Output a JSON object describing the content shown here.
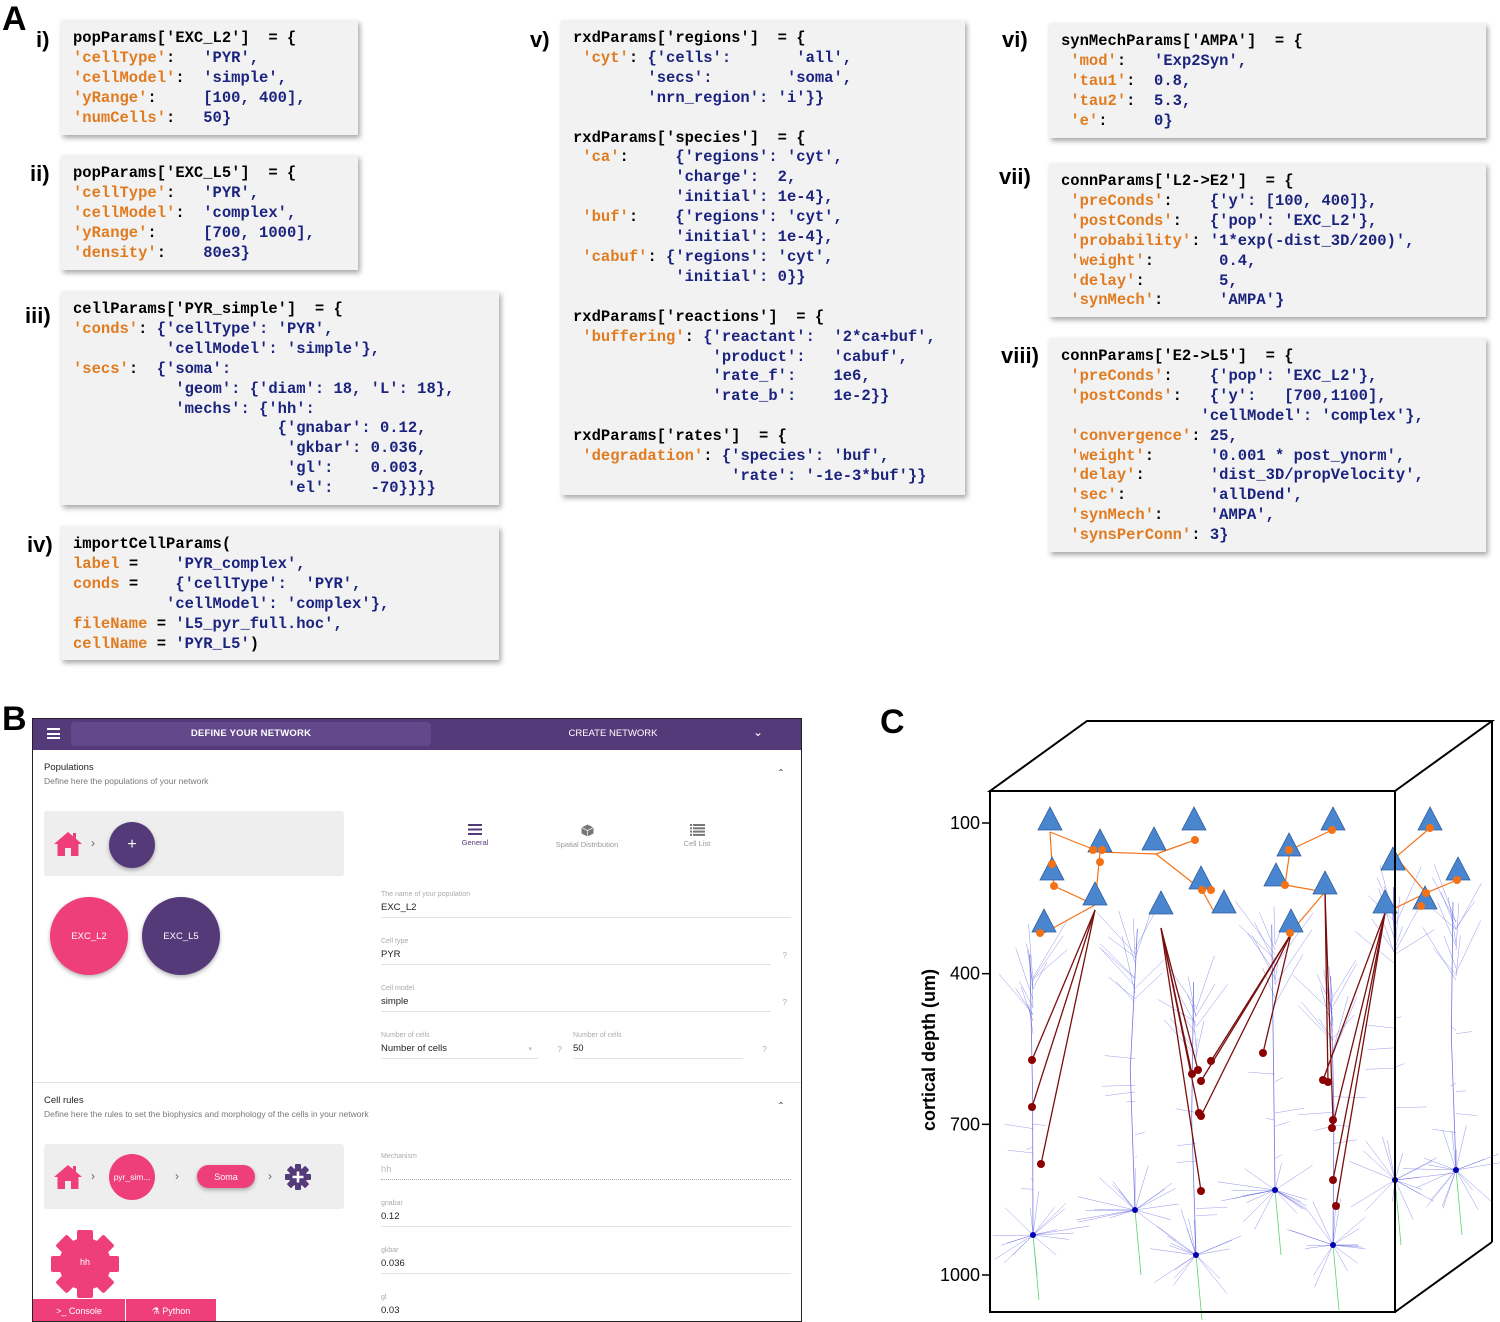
{
  "panel_labels": {
    "A": "A",
    "B": "B",
    "C": "C"
  },
  "sub_labels": [
    "i)",
    "ii)",
    "iii)",
    "iv)",
    "v)",
    "vi)",
    "vii)",
    "viii)"
  ],
  "code_blocks": [
    {
      "id": "i",
      "lines": [
        [
          [
            "p",
            "popParams['EXC_L2']  = {"
          ]
        ],
        [
          [
            "k",
            "'cellType'"
          ],
          [
            "p",
            ":   "
          ],
          [
            "v",
            "'PYR',"
          ]
        ],
        [
          [
            "k",
            "'cellModel'"
          ],
          [
            "p",
            ":  "
          ],
          [
            "v",
            "'simple',"
          ]
        ],
        [
          [
            "k",
            "'yRange'"
          ],
          [
            "p",
            ":     "
          ],
          [
            "v",
            "[100, 400],"
          ]
        ],
        [
          [
            "k",
            "'numCells'"
          ],
          [
            "p",
            ":   "
          ],
          [
            "v",
            "50}"
          ]
        ]
      ]
    },
    {
      "id": "ii",
      "lines": [
        [
          [
            "p",
            "popParams['EXC_L5']  = {"
          ]
        ],
        [
          [
            "k",
            "'cellType'"
          ],
          [
            "p",
            ":   "
          ],
          [
            "v",
            "'PYR',"
          ]
        ],
        [
          [
            "k",
            "'cellModel'"
          ],
          [
            "p",
            ":  "
          ],
          [
            "v",
            "'complex',"
          ]
        ],
        [
          [
            "k",
            "'yRange'"
          ],
          [
            "p",
            ":     "
          ],
          [
            "v",
            "[700, 1000],"
          ]
        ],
        [
          [
            "k",
            "'density'"
          ],
          [
            "p",
            ":    "
          ],
          [
            "v",
            "80e3}"
          ]
        ]
      ]
    },
    {
      "id": "iii",
      "lines": [
        [
          [
            "p",
            "cellParams['PYR_simple']  = {"
          ]
        ],
        [
          [
            "k",
            "'conds'"
          ],
          [
            "p",
            ": "
          ],
          [
            "v",
            "{'cellType': 'PYR',"
          ]
        ],
        [
          [
            "p",
            "          "
          ],
          [
            "v",
            "'cellModel': 'simple'},"
          ]
        ],
        [
          [
            "k",
            "'secs'"
          ],
          [
            "p",
            ":  "
          ],
          [
            "v",
            "{'soma':"
          ]
        ],
        [
          [
            "p",
            "           "
          ],
          [
            "v",
            "'geom': {'diam': 18, 'L': 18},"
          ]
        ],
        [
          [
            "p",
            "           "
          ],
          [
            "v",
            "'mechs': {'hh':"
          ]
        ],
        [
          [
            "p",
            "                      "
          ],
          [
            "v",
            "{'gnabar': 0.12,"
          ]
        ],
        [
          [
            "p",
            "                       "
          ],
          [
            "v",
            "'gkbar': 0.036,"
          ]
        ],
        [
          [
            "p",
            "                       "
          ],
          [
            "v",
            "'gl':    0.003,"
          ]
        ],
        [
          [
            "p",
            "                       "
          ],
          [
            "v",
            "'el':    -70}}}}"
          ]
        ]
      ]
    },
    {
      "id": "iv",
      "lines": [
        [
          [
            "p",
            "importCellParams("
          ]
        ],
        [
          [
            "k",
            "label"
          ],
          [
            "p",
            " =    "
          ],
          [
            "v",
            "'PYR_complex',"
          ]
        ],
        [
          [
            "k",
            "conds"
          ],
          [
            "p",
            " =    "
          ],
          [
            "v",
            "{'cellType':  'PYR',"
          ]
        ],
        [
          [
            "p",
            "          "
          ],
          [
            "v",
            "'cellModel': 'complex'},"
          ]
        ],
        [
          [
            "k",
            "fileName"
          ],
          [
            "p",
            " = "
          ],
          [
            "v",
            "'L5_pyr_full.hoc',"
          ]
        ],
        [
          [
            "k",
            "cellName"
          ],
          [
            "p",
            " = "
          ],
          [
            "v",
            "'PYR_L5'"
          ],
          [
            "p",
            ")"
          ]
        ]
      ]
    },
    {
      "id": "v",
      "lines": [
        [
          [
            "p",
            "rxdParams['regions']  = {"
          ]
        ],
        [
          [
            "p",
            " "
          ],
          [
            "k",
            "'cyt'"
          ],
          [
            "p",
            ": "
          ],
          [
            "v",
            "{'cells':       'all',"
          ]
        ],
        [
          [
            "p",
            "        "
          ],
          [
            "v",
            "'secs':        'soma',"
          ]
        ],
        [
          [
            "p",
            "        "
          ],
          [
            "v",
            "'nrn_region': 'i'}}"
          ]
        ],
        [
          [
            "p",
            ""
          ]
        ],
        [
          [
            "p",
            "rxdParams['species']  = {"
          ]
        ],
        [
          [
            "p",
            " "
          ],
          [
            "k",
            "'ca'"
          ],
          [
            "p",
            ":     "
          ],
          [
            "v",
            "{'regions': 'cyt',"
          ]
        ],
        [
          [
            "p",
            "           "
          ],
          [
            "v",
            "'charge':  2,"
          ]
        ],
        [
          [
            "p",
            "           "
          ],
          [
            "v",
            "'initial': 1e-4},"
          ]
        ],
        [
          [
            "p",
            " "
          ],
          [
            "k",
            "'buf'"
          ],
          [
            "p",
            ":    "
          ],
          [
            "v",
            "{'regions': 'cyt',"
          ]
        ],
        [
          [
            "p",
            "           "
          ],
          [
            "v",
            "'initial': 1e-4},"
          ]
        ],
        [
          [
            "p",
            " "
          ],
          [
            "k",
            "'cabuf'"
          ],
          [
            "p",
            ": "
          ],
          [
            "v",
            "{'regions': 'cyt',"
          ]
        ],
        [
          [
            "p",
            "           "
          ],
          [
            "v",
            "'initial': 0}}"
          ]
        ],
        [
          [
            "p",
            ""
          ]
        ],
        [
          [
            "p",
            "rxdParams['reactions']  = {"
          ]
        ],
        [
          [
            "p",
            " "
          ],
          [
            "k",
            "'buffering'"
          ],
          [
            "p",
            ": "
          ],
          [
            "v",
            "{'reactant':  '2*ca+buf',"
          ]
        ],
        [
          [
            "p",
            "               "
          ],
          [
            "v",
            "'product':   'cabuf',"
          ]
        ],
        [
          [
            "p",
            "               "
          ],
          [
            "v",
            "'rate_f':    1e6,"
          ]
        ],
        [
          [
            "p",
            "               "
          ],
          [
            "v",
            "'rate_b':    1e-2}}"
          ]
        ],
        [
          [
            "p",
            ""
          ]
        ],
        [
          [
            "p",
            "rxdParams['rates']  = {"
          ]
        ],
        [
          [
            "p",
            " "
          ],
          [
            "k",
            "'degradation'"
          ],
          [
            "p",
            ": "
          ],
          [
            "v",
            "{'species': 'buf',"
          ]
        ],
        [
          [
            "p",
            "                 "
          ],
          [
            "v",
            "'rate': '-1e-3*buf'}}"
          ]
        ]
      ]
    },
    {
      "id": "vi",
      "lines": [
        [
          [
            "p",
            "synMechParams['AMPA']  = {"
          ]
        ],
        [
          [
            "p",
            " "
          ],
          [
            "k",
            "'mod'"
          ],
          [
            "p",
            ":   "
          ],
          [
            "v",
            "'Exp2Syn',"
          ]
        ],
        [
          [
            "p",
            " "
          ],
          [
            "k",
            "'tau1'"
          ],
          [
            "p",
            ":  "
          ],
          [
            "v",
            "0.8,"
          ]
        ],
        [
          [
            "p",
            " "
          ],
          [
            "k",
            "'tau2'"
          ],
          [
            "p",
            ":  "
          ],
          [
            "v",
            "5.3,"
          ]
        ],
        [
          [
            "p",
            " "
          ],
          [
            "k",
            "'e'"
          ],
          [
            "p",
            ":     "
          ],
          [
            "v",
            "0}"
          ]
        ]
      ]
    },
    {
      "id": "vii",
      "lines": [
        [
          [
            "p",
            "connParams['L2->E2']  = {"
          ]
        ],
        [
          [
            "p",
            " "
          ],
          [
            "k",
            "'preConds'"
          ],
          [
            "p",
            ":    "
          ],
          [
            "v",
            "{'y': [100, 400]},"
          ]
        ],
        [
          [
            "p",
            " "
          ],
          [
            "k",
            "'postConds'"
          ],
          [
            "p",
            ":   "
          ],
          [
            "v",
            "{'pop': 'EXC_L2'},"
          ]
        ],
        [
          [
            "p",
            " "
          ],
          [
            "k",
            "'probability'"
          ],
          [
            "p",
            ": "
          ],
          [
            "v",
            "'1*exp(-dist_3D/200)',"
          ]
        ],
        [
          [
            "p",
            " "
          ],
          [
            "k",
            "'weight'"
          ],
          [
            "p",
            ":       "
          ],
          [
            "v",
            "0.4,"
          ]
        ],
        [
          [
            "p",
            " "
          ],
          [
            "k",
            "'delay'"
          ],
          [
            "p",
            ":        "
          ],
          [
            "v",
            "5,"
          ]
        ],
        [
          [
            "p",
            " "
          ],
          [
            "k",
            "'synMech'"
          ],
          [
            "p",
            ":      "
          ],
          [
            "v",
            "'AMPA'}"
          ]
        ]
      ]
    },
    {
      "id": "viii",
      "lines": [
        [
          [
            "p",
            "connParams['E2->L5']  = {"
          ]
        ],
        [
          [
            "p",
            " "
          ],
          [
            "k",
            "'preConds'"
          ],
          [
            "p",
            ":    "
          ],
          [
            "v",
            "{'pop': 'EXC_L2'},"
          ]
        ],
        [
          [
            "p",
            " "
          ],
          [
            "k",
            "'postConds'"
          ],
          [
            "p",
            ":   "
          ],
          [
            "v",
            "{'y':   [700,1100],"
          ]
        ],
        [
          [
            "p",
            "               "
          ],
          [
            "v",
            "'cellModel': 'complex'},"
          ]
        ],
        [
          [
            "p",
            " "
          ],
          [
            "k",
            "'convergence'"
          ],
          [
            "p",
            ": "
          ],
          [
            "v",
            "25,"
          ]
        ],
        [
          [
            "p",
            " "
          ],
          [
            "k",
            "'weight'"
          ],
          [
            "p",
            ":      "
          ],
          [
            "v",
            "'0.001 * post_ynorm',"
          ]
        ],
        [
          [
            "p",
            " "
          ],
          [
            "k",
            "'delay'"
          ],
          [
            "p",
            ":       "
          ],
          [
            "v",
            "'dist_3D/propVelocity',"
          ]
        ],
        [
          [
            "p",
            " "
          ],
          [
            "k",
            "'sec'"
          ],
          [
            "p",
            ":         "
          ],
          [
            "v",
            "'allDend',"
          ]
        ],
        [
          [
            "p",
            " "
          ],
          [
            "k",
            "'synMech'"
          ],
          [
            "p",
            ":     "
          ],
          [
            "v",
            "'AMPA',"
          ]
        ],
        [
          [
            "p",
            " "
          ],
          [
            "k",
            "'synsPerConn'"
          ],
          [
            "p",
            ": "
          ],
          [
            "v",
            "3}"
          ]
        ]
      ]
    }
  ],
  "app": {
    "header": {
      "tab_define": "DEFINE YOUR NETWORK",
      "tab_create": "CREATE NETWORK",
      "menu_icon": "hamburger-icon",
      "expand_icon": "chevron-down-icon"
    },
    "populations": {
      "title": "Populations",
      "subtitle": "Define here the populations of your network",
      "add_label": "+",
      "items": [
        {
          "label": "EXC_L2",
          "color": "#ef3f7b"
        },
        {
          "label": "EXC_L5",
          "color": "#553a7a"
        }
      ],
      "tabs": [
        {
          "label": "General",
          "icon": "menu-lines-icon",
          "active": true
        },
        {
          "label": "Spatial Distribution",
          "icon": "cube-icon",
          "active": false
        },
        {
          "label": "Cell List",
          "icon": "list-icon",
          "active": false
        }
      ],
      "fields": {
        "name_label": "The name of your population",
        "name_value": "EXC_L2",
        "celltype_label": "Cell type",
        "celltype_value": "PYR",
        "cellmodel_label": "Cell model",
        "cellmodel_value": "simple",
        "numcells_select_label": "Number of cells",
        "numcells_select_value": "Number of cells",
        "numcells_label": "Number of cells",
        "numcells_value": "50",
        "help": "?"
      }
    },
    "cell_rules": {
      "title": "Cell rules",
      "subtitle": "Define here the rules to set the biophysics and morphology of the cells in your network",
      "crumb_rule": "pyr_sim...",
      "crumb_section": "Soma",
      "mechanism_chip": "hh",
      "fields": {
        "mechanism_label": "Mechanism",
        "mechanism_value": "hh",
        "gnabar_label": "gnabar",
        "gnabar_value": "0.12",
        "gkbar_label": "gkbar",
        "gkbar_value": "0.036",
        "gl_label": "gl",
        "gl_value": "0.03"
      }
    },
    "footer": {
      "console": ">_ Console",
      "python": "⚗ Python"
    },
    "colors": {
      "primary": "#553a7a",
      "accent": "#ef3f7b",
      "crumb_bg": "#eeeeee"
    }
  },
  "panel_c": {
    "ylabel": "cortical depth (um)",
    "yticks": [
      100,
      400,
      700,
      1000
    ],
    "ylim": [
      100,
      1000
    ],
    "colors": {
      "l2_cell": "#4a86d0",
      "l2_syn": "#f47216",
      "l2_conn": "#f47216",
      "l5_conn": "#7a0e0e",
      "l5_syn": "#8b0000",
      "dendrite": "#3a3ad8",
      "axon": "#5dd36a"
    }
  }
}
